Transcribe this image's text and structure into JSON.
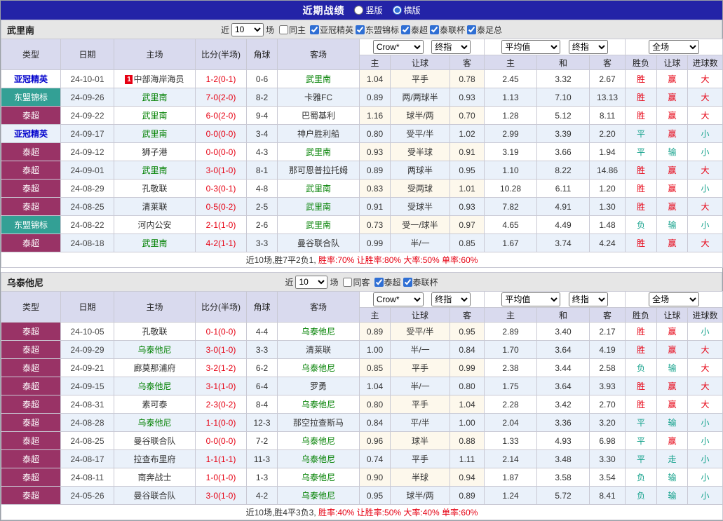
{
  "colors": {
    "topbar_bg": "#2323a7",
    "header_bg": "#d9daee",
    "strip_bg": "#e6e6e6",
    "row_alt_bg": "#eaf1fa",
    "odds_tint_bg": "#fdf8ec",
    "acl_text": "#0000cc",
    "aff_bg": "#33a095",
    "thai_bg": "#993366",
    "focus_team": "#008000",
    "score_red": "#e60012",
    "win_red": "#e60012",
    "lose_teal": "#13a18b",
    "summary_red": "#e60012"
  },
  "top_bar": {
    "title": "近期战绩",
    "layout_options": [
      {
        "label": "竖版",
        "selected": false
      },
      {
        "label": "横版",
        "selected": true
      }
    ]
  },
  "filter": {
    "recent_label": "近",
    "recent_value": "10",
    "matches_label": "场"
  },
  "table_header": {
    "col_type": "类型",
    "col_date": "日期",
    "col_home": "主场",
    "col_score": "比分(半场)",
    "col_corner": "角球",
    "col_away": "客场",
    "odds_source": "Crow*",
    "odds_stage": "终指",
    "avg_source": "平均值",
    "avg_stage": "终指",
    "scope": "全场",
    "sub_home": "主",
    "sub_handicap": "让球",
    "sub_away": "客",
    "sub_avg_home": "主",
    "sub_avg_draw": "和",
    "sub_avg_away": "客",
    "sub_result": "胜负",
    "sub_asian_result": "让球",
    "sub_goals": "进球数"
  },
  "sections": [
    {
      "team": "武里南",
      "same_label": "同主",
      "same_checked": false,
      "leagues": [
        {
          "label": "亚冠精英",
          "checked": true
        },
        {
          "label": "东盟锦标",
          "checked": true
        },
        {
          "label": "泰超",
          "checked": true
        },
        {
          "label": "泰联杯",
          "checked": true
        },
        {
          "label": "泰足总",
          "checked": true
        }
      ],
      "rows": [
        {
          "type": "亚冠精英",
          "date": "24-10-01",
          "home": "中部海岸海员",
          "home_badge": "1",
          "home_focus": false,
          "score": "1-2(0-1)",
          "corner": "0-6",
          "away": "武里南",
          "away_focus": true,
          "odds": [
            "1.04",
            "平手",
            "0.78"
          ],
          "avg": [
            "2.45",
            "3.32",
            "2.67"
          ],
          "results": [
            "胜",
            "赢",
            "大"
          ]
        },
        {
          "type": "东盟锦标",
          "date": "24-09-26",
          "home": "武里南",
          "home_focus": true,
          "score": "7-0(2-0)",
          "corner": "8-2",
          "away": "卡雅FC",
          "away_focus": false,
          "odds": [
            "0.89",
            "两/两球半",
            "0.93"
          ],
          "avg": [
            "1.13",
            "7.10",
            "13.13"
          ],
          "results": [
            "胜",
            "赢",
            "大"
          ]
        },
        {
          "type": "泰超",
          "date": "24-09-22",
          "home": "武里南",
          "home_focus": true,
          "score": "6-0(2-0)",
          "corner": "9-4",
          "away": "巴蜀基利",
          "away_focus": false,
          "odds": [
            "1.16",
            "球半/两",
            "0.70"
          ],
          "avg": [
            "1.28",
            "5.12",
            "8.11"
          ],
          "results": [
            "胜",
            "赢",
            "大"
          ]
        },
        {
          "type": "亚冠精英",
          "date": "24-09-17",
          "home": "武里南",
          "home_focus": true,
          "score": "0-0(0-0)",
          "corner": "3-4",
          "away": "神户胜利船",
          "away_focus": false,
          "odds": [
            "0.80",
            "受平/半",
            "1.02"
          ],
          "avg": [
            "2.99",
            "3.39",
            "2.20"
          ],
          "results": [
            "平",
            "赢",
            "小"
          ]
        },
        {
          "type": "泰超",
          "date": "24-09-12",
          "home": "狮子港",
          "home_focus": false,
          "score": "0-0(0-0)",
          "corner": "4-3",
          "away": "武里南",
          "away_focus": true,
          "odds": [
            "0.93",
            "受半球",
            "0.91"
          ],
          "avg": [
            "3.19",
            "3.66",
            "1.94"
          ],
          "results": [
            "平",
            "输",
            "小"
          ]
        },
        {
          "type": "泰超",
          "date": "24-09-01",
          "home": "武里南",
          "home_focus": true,
          "score": "3-0(1-0)",
          "corner": "8-1",
          "away": "那可恩普拉托姆",
          "away_focus": false,
          "odds": [
            "0.89",
            "两球半",
            "0.95"
          ],
          "avg": [
            "1.10",
            "8.22",
            "14.86"
          ],
          "results": [
            "胜",
            "赢",
            "大"
          ]
        },
        {
          "type": "泰超",
          "date": "24-08-29",
          "home": "孔敬联",
          "home_focus": false,
          "score": "0-3(0-1)",
          "corner": "4-8",
          "away": "武里南",
          "away_focus": true,
          "odds": [
            "0.83",
            "受两球",
            "1.01"
          ],
          "avg": [
            "10.28",
            "6.11",
            "1.20"
          ],
          "results": [
            "胜",
            "赢",
            "小"
          ]
        },
        {
          "type": "泰超",
          "date": "24-08-25",
          "home": "清莱联",
          "home_focus": false,
          "score": "0-5(0-2)",
          "corner": "2-5",
          "away": "武里南",
          "away_focus": true,
          "odds": [
            "0.91",
            "受球半",
            "0.93"
          ],
          "avg": [
            "7.82",
            "4.91",
            "1.30"
          ],
          "results": [
            "胜",
            "赢",
            "大"
          ]
        },
        {
          "type": "东盟锦标",
          "date": "24-08-22",
          "home": "河内公安",
          "home_focus": false,
          "score": "2-1(1-0)",
          "corner": "2-6",
          "away": "武里南",
          "away_focus": true,
          "odds": [
            "0.73",
            "受一/球半",
            "0.97"
          ],
          "avg": [
            "4.65",
            "4.49",
            "1.48"
          ],
          "results": [
            "负",
            "输",
            "小"
          ]
        },
        {
          "type": "泰超",
          "date": "24-08-18",
          "home": "武里南",
          "home_focus": true,
          "score": "4-2(1-1)",
          "corner": "3-3",
          "away": "曼谷联合队",
          "away_focus": false,
          "odds": [
            "0.99",
            "半/一",
            "0.85"
          ],
          "avg": [
            "1.67",
            "3.74",
            "4.24"
          ],
          "results": [
            "胜",
            "赢",
            "大"
          ]
        }
      ],
      "summary_prefix": "近10场,胜7平2负1, ",
      "summary_stats": "胜率:70% 让胜率:80% 大率:50% 单率:60%"
    },
    {
      "team": "乌泰他尼",
      "same_label": "同客",
      "same_checked": false,
      "leagues": [
        {
          "label": "泰超",
          "checked": true
        },
        {
          "label": "泰联杯",
          "checked": true
        }
      ],
      "rows": [
        {
          "type": "泰超",
          "date": "24-10-05",
          "home": "孔敬联",
          "home_focus": false,
          "score": "0-1(0-0)",
          "corner": "4-4",
          "away": "乌泰他尼",
          "away_focus": true,
          "odds": [
            "0.89",
            "受平/半",
            "0.95"
          ],
          "avg": [
            "2.89",
            "3.40",
            "2.17"
          ],
          "results": [
            "胜",
            "赢",
            "小"
          ]
        },
        {
          "type": "泰超",
          "date": "24-09-29",
          "home": "乌泰他尼",
          "home_focus": true,
          "score": "3-0(1-0)",
          "corner": "3-3",
          "away": "清莱联",
          "away_focus": false,
          "odds": [
            "1.00",
            "半/一",
            "0.84"
          ],
          "avg": [
            "1.70",
            "3.64",
            "4.19"
          ],
          "results": [
            "胜",
            "赢",
            "大"
          ]
        },
        {
          "type": "泰超",
          "date": "24-09-21",
          "home": "廊莫那浦府",
          "home_focus": false,
          "score": "3-2(1-2)",
          "corner": "6-2",
          "away": "乌泰他尼",
          "away_focus": true,
          "odds": [
            "0.85",
            "平手",
            "0.99"
          ],
          "avg": [
            "2.38",
            "3.44",
            "2.58"
          ],
          "results": [
            "负",
            "输",
            "大"
          ]
        },
        {
          "type": "泰超",
          "date": "24-09-15",
          "home": "乌泰他尼",
          "home_focus": true,
          "score": "3-1(1-0)",
          "corner": "6-4",
          "away": "罗勇",
          "away_focus": false,
          "odds": [
            "1.04",
            "半/一",
            "0.80"
          ],
          "avg": [
            "1.75",
            "3.64",
            "3.93"
          ],
          "results": [
            "胜",
            "赢",
            "大"
          ]
        },
        {
          "type": "泰超",
          "date": "24-08-31",
          "home": "素可泰",
          "home_focus": false,
          "score": "2-3(0-2)",
          "corner": "8-4",
          "away": "乌泰他尼",
          "away_focus": true,
          "odds": [
            "0.80",
            "平手",
            "1.04"
          ],
          "avg": [
            "2.28",
            "3.42",
            "2.70"
          ],
          "results": [
            "胜",
            "赢",
            "大"
          ]
        },
        {
          "type": "泰超",
          "date": "24-08-28",
          "home": "乌泰他尼",
          "home_focus": true,
          "score": "1-1(0-0)",
          "corner": "12-3",
          "away": "那空拉查斯马",
          "away_focus": false,
          "odds": [
            "0.84",
            "平/半",
            "1.00"
          ],
          "avg": [
            "2.04",
            "3.36",
            "3.20"
          ],
          "results": [
            "平",
            "输",
            "小"
          ]
        },
        {
          "type": "泰超",
          "date": "24-08-25",
          "home": "曼谷联合队",
          "home_focus": false,
          "score": "0-0(0-0)",
          "corner": "7-2",
          "away": "乌泰他尼",
          "away_focus": true,
          "odds": [
            "0.96",
            "球半",
            "0.88"
          ],
          "avg": [
            "1.33",
            "4.93",
            "6.98"
          ],
          "results": [
            "平",
            "赢",
            "小"
          ]
        },
        {
          "type": "泰超",
          "date": "24-08-17",
          "home": "拉查布里府",
          "home_focus": false,
          "score": "1-1(1-1)",
          "corner": "11-3",
          "away": "乌泰他尼",
          "away_focus": true,
          "odds": [
            "0.74",
            "平手",
            "1.11"
          ],
          "avg": [
            "2.14",
            "3.48",
            "3.30"
          ],
          "results": [
            "平",
            "走",
            "小"
          ]
        },
        {
          "type": "泰超",
          "date": "24-08-11",
          "home": "南奔战士",
          "home_focus": false,
          "score": "1-0(1-0)",
          "corner": "1-3",
          "away": "乌泰他尼",
          "away_focus": true,
          "odds": [
            "0.90",
            "半球",
            "0.94"
          ],
          "avg": [
            "1.87",
            "3.58",
            "3.54"
          ],
          "results": [
            "负",
            "输",
            "小"
          ]
        },
        {
          "type": "泰超",
          "date": "24-05-26",
          "home": "曼谷联合队",
          "home_focus": false,
          "score": "3-0(1-0)",
          "corner": "4-2",
          "away": "乌泰他尼",
          "away_focus": true,
          "odds": [
            "0.95",
            "球半/两",
            "0.89"
          ],
          "avg": [
            "1.24",
            "5.72",
            "8.41"
          ],
          "results": [
            "负",
            "输",
            "小"
          ]
        }
      ],
      "summary_prefix": "近10场,胜4平3负3, ",
      "summary_stats": "胜率:40% 让胜率:50% 大率:40% 单率:60%"
    }
  ]
}
